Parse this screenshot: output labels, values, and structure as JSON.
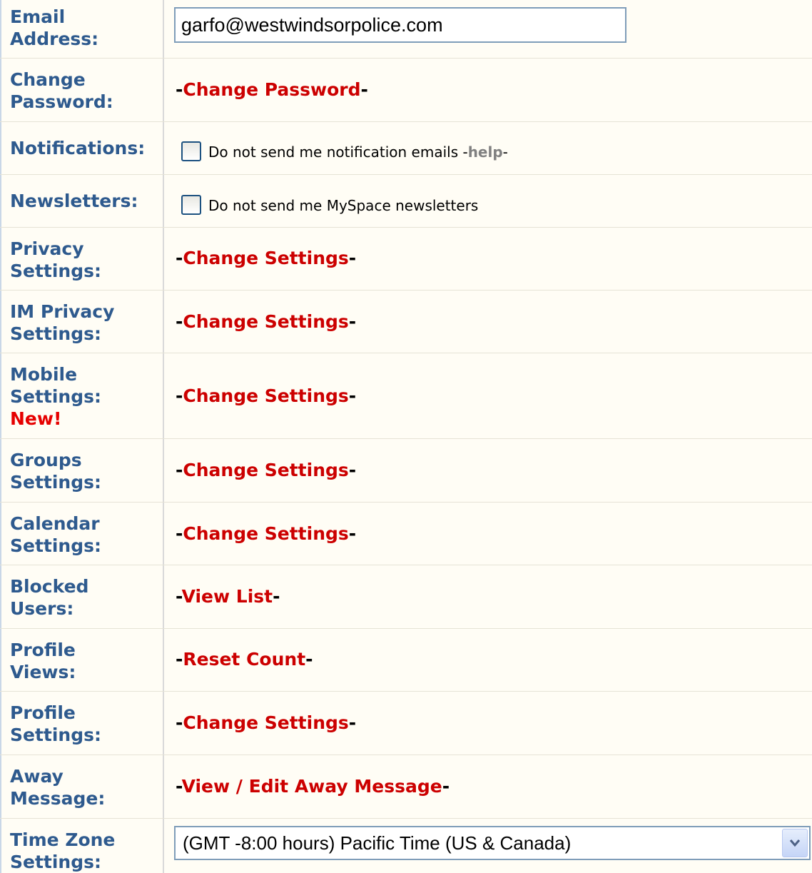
{
  "email": {
    "label": "Email Address:",
    "value": "garfo@westwindsorpolice.com"
  },
  "change_password": {
    "label": "Change Password:",
    "link": "Change Password"
  },
  "notifications": {
    "label": "Notifications:",
    "checkbox_text": "Do not send me notification emails",
    "help": "help",
    "checked": false
  },
  "newsletters": {
    "label": "Newsletters:",
    "checkbox_text": "Do not send me MySpace newsletters",
    "checked": false
  },
  "privacy": {
    "label": "Privacy Settings:",
    "link": "Change Settings"
  },
  "im_privacy": {
    "label": "IM Privacy Settings:",
    "link": "Change Settings"
  },
  "mobile": {
    "label": "Mobile Settings:",
    "badge": "New!",
    "link": "Change Settings"
  },
  "groups": {
    "label": "Groups Settings:",
    "link": "Change Settings"
  },
  "calendar": {
    "label": "Calendar Settings:",
    "link": "Change Settings"
  },
  "blocked": {
    "label": "Blocked Users:",
    "link": "View List"
  },
  "profile_views": {
    "label": "Profile Views:",
    "link": "Reset Count"
  },
  "profile_settings": {
    "label": "Profile Settings:",
    "link": "Change Settings"
  },
  "away": {
    "label": "Away Message:",
    "link": "View / Edit Away Message"
  },
  "timezone": {
    "label": "Time Zone Settings:",
    "selected": "(GMT -8:00 hours) Pacific Time (US & Canada)"
  },
  "colors": {
    "label_blue": "#2e5a8e",
    "link_red": "#cc0000",
    "new_red": "#e60000",
    "row_bg": "#fffdf5"
  },
  "icons": {
    "dropdown": "chevron-down-icon"
  }
}
